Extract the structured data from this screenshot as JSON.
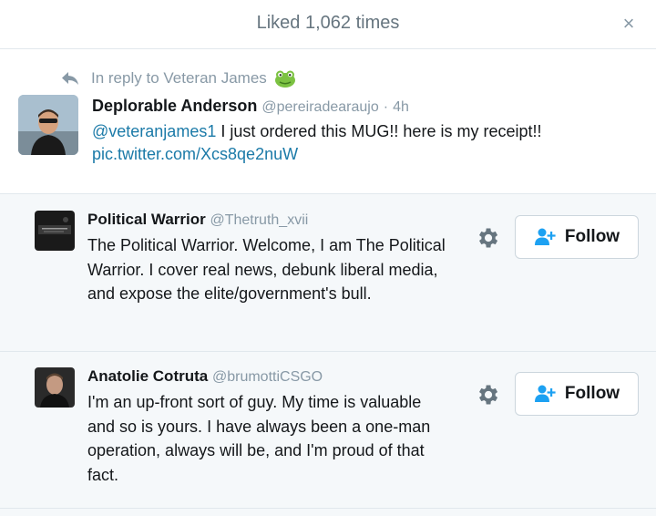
{
  "modal": {
    "title": "Liked 1,062 times",
    "close_label": "×"
  },
  "tweet": {
    "reply_prefix": "In reply to",
    "reply_to": "Veteran James",
    "author_name": "Deplorable Anderson",
    "author_handle": "@pereiradearaujo",
    "separator": "·",
    "time": "4h",
    "mention": "@veteranjames1",
    "text": "I just ordered this MUG!! here is my receipt!!",
    "pic_link": "pic.twitter.com/Xcs8qe2nuW"
  },
  "users": [
    {
      "name": "Political Warrior",
      "handle": "@Thetruth_xvii",
      "bio": "The Political Warrior. Welcome, I am The Political Warrior. I cover real news, debunk liberal media, and expose the elite/government's bull.",
      "follow_label": "Follow"
    },
    {
      "name": "Anatolie Cotruta",
      "handle": "@brumottiCSGO",
      "bio": "I'm an up-front sort of guy. My time is valuable and so is yours. I have always been a one-man operation, always will be, and I'm proud of that fact.",
      "follow_label": "Follow"
    }
  ],
  "colors": {
    "link": "#1b7aa8",
    "muted": "#8899a6",
    "list_bg": "#f5f8fa"
  },
  "icons": {
    "reply": "reply-arrow-icon",
    "frog": "frog-emoji-icon",
    "gear": "gear-icon",
    "follow": "add-user-icon",
    "close": "close-icon"
  }
}
